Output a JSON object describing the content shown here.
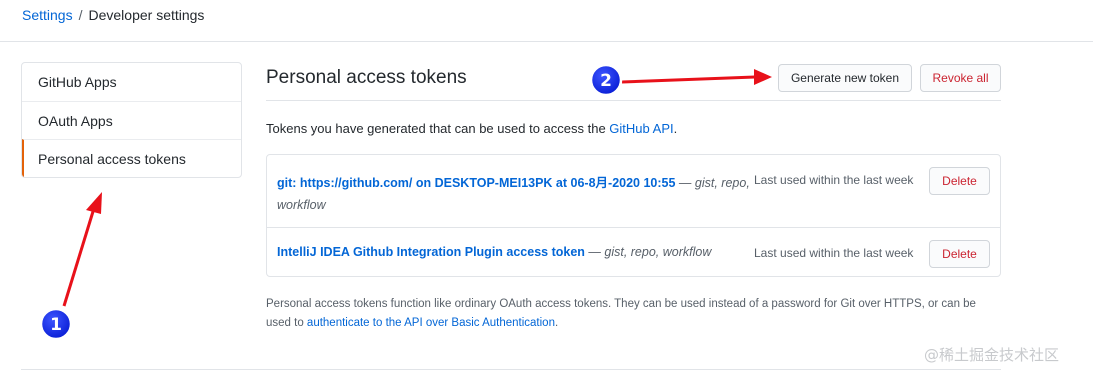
{
  "breadcrumb": {
    "settings": "Settings",
    "separator": "/",
    "current": "Developer settings"
  },
  "sidebar": {
    "items": [
      {
        "label": "GitHub Apps"
      },
      {
        "label": "OAuth Apps"
      },
      {
        "label": "Personal access tokens",
        "selected": true
      }
    ]
  },
  "main": {
    "title": "Personal access tokens",
    "generate_label": "Generate new token",
    "revoke_label": "Revoke all",
    "intro_text": "Tokens you have generated that can be used to access the ",
    "intro_link": "GitHub API",
    "intro_end": "."
  },
  "tokens": [
    {
      "name": "git: https://github.com/ on DESKTOP-MEI13PK at 06-8月-2020 10:55",
      "dash": " — ",
      "scopes_inline": "gist, repo,",
      "scopes_wrap": "workflow",
      "last_used": "Last used within the last week",
      "delete_label": "Delete"
    },
    {
      "name": "IntelliJ IDEA Github Integration Plugin access token",
      "dash": " — ",
      "scopes_inline": "gist, repo, workflow",
      "last_used": "Last used within the last week",
      "delete_label": "Delete"
    }
  ],
  "footnote": {
    "text": "Personal access tokens function like ordinary OAuth access tokens. They can be used instead of a password for Git over HTTPS, or can be used to ",
    "link": "authenticate to the API over Basic Authentication",
    "end": "."
  },
  "annotations": {
    "badge1": "1",
    "badge2": "2"
  },
  "watermark": "@稀土掘金技术社区",
  "colors": {
    "link": "#0366d6",
    "danger": "#cb2431",
    "selected_accent": "#e36209",
    "arrow": "#e8111a",
    "badge": "#0a1fd6"
  }
}
